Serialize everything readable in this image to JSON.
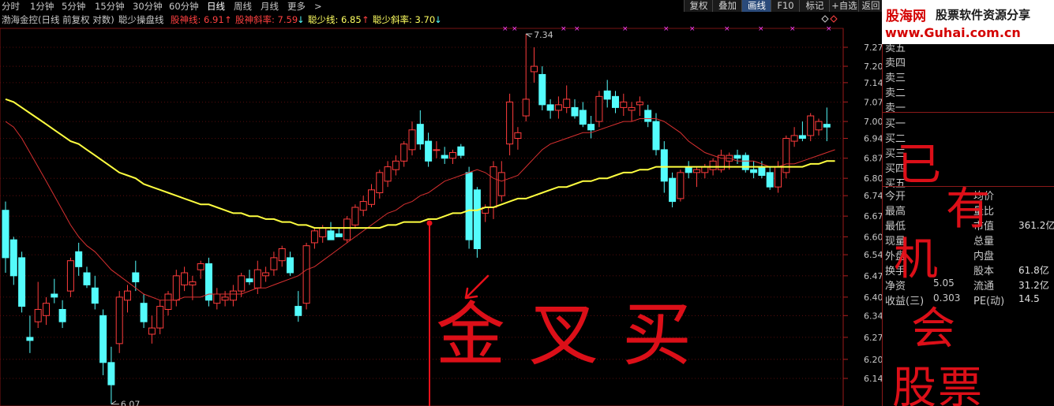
{
  "colors": {
    "up": "#ff3c3c",
    "down": "#54fcfc",
    "ma_red": "#d83030",
    "ma_yellow": "#ffff40",
    "grid": "#6e1010",
    "handwriting": "#e8101a"
  },
  "toolbar": {
    "periods": [
      "分时",
      "1分钟",
      "5分钟",
      "15分钟",
      "30分钟",
      "60分钟",
      "日线",
      "周线",
      "月线",
      "更多",
      ">"
    ],
    "active_period": "日线",
    "right_buttons": [
      "复权",
      "叠加",
      "画线",
      "F10",
      "标记",
      "+自选",
      "返回"
    ],
    "active_button": "画线"
  },
  "indicator": {
    "title": "渤海金控(日线 前复权 对数)",
    "formula": "聪少操盘线",
    "gs_label": "股神线: 6.91",
    "gs_slope_label": "股神斜率: 7.59",
    "cs_label": "聪少线: 6.85",
    "cs_slope_label": "聪少斜率: 3.70",
    "up_arrow": "↑",
    "down_arrow": "↓"
  },
  "price_axis": {
    "ticks": [
      "7.27",
      "7.20",
      "7.14",
      "7.07",
      "7.00",
      "6.94",
      "6.87",
      "6.80",
      "6.74",
      "6.67",
      "6.60",
      "6.54",
      "6.47",
      "6.40",
      "6.34",
      "6.27",
      "6.20",
      "6.14"
    ]
  },
  "annotations": {
    "high_label": "7.34",
    "low_label": "6.07",
    "marker": "×"
  },
  "handwriting": {
    "main": "金叉买",
    "side": "已有机会股票"
  },
  "panel": {
    "order_book": [
      "卖五",
      "卖四",
      "卖三",
      "卖二",
      "卖一",
      "买一",
      "买二",
      "买三",
      "买四",
      "买五"
    ],
    "stats_left": [
      "今开",
      "最高",
      "最低",
      "现量",
      "外盘",
      "换手",
      "净资",
      "收益(三)"
    ],
    "stats_left_values": [
      "",
      "",
      "",
      "",
      "",
      "",
      "5.05",
      "0.303"
    ],
    "stats_right": [
      "均价",
      "量比",
      "市值",
      "总量",
      "内盘",
      "股本",
      "流通",
      "PE(动)"
    ],
    "stats_right_values": [
      "",
      "",
      "361.2亿",
      "",
      "",
      "61.8亿",
      "31.2亿",
      "14.5"
    ]
  },
  "logo": {
    "brand": "股海网",
    "slogan": "股票软件资源分享",
    "url": "www.Guhai.com.cn"
  },
  "candles": [
    {
      "o": 6.69,
      "h": 6.72,
      "l": 6.48,
      "c": 6.53
    },
    {
      "o": 6.59,
      "h": 6.6,
      "l": 6.44,
      "c": 6.47
    },
    {
      "o": 6.53,
      "h": 6.55,
      "l": 6.35,
      "c": 6.37
    },
    {
      "o": 6.27,
      "h": 6.34,
      "l": 6.22,
      "c": 6.26
    },
    {
      "o": 6.32,
      "h": 6.45,
      "l": 6.3,
      "c": 6.36
    },
    {
      "o": 6.34,
      "h": 6.4,
      "l": 6.31,
      "c": 6.38
    },
    {
      "o": 6.41,
      "h": 6.46,
      "l": 6.38,
      "c": 6.4
    },
    {
      "o": 6.36,
      "h": 6.39,
      "l": 6.3,
      "c": 6.32
    },
    {
      "o": 6.42,
      "h": 6.53,
      "l": 6.4,
      "c": 6.52
    },
    {
      "o": 6.55,
      "h": 6.58,
      "l": 6.47,
      "c": 6.5
    },
    {
      "o": 6.48,
      "h": 6.5,
      "l": 6.43,
      "c": 6.44
    },
    {
      "o": 6.43,
      "h": 6.47,
      "l": 6.36,
      "c": 6.38
    },
    {
      "o": 6.34,
      "h": 6.36,
      "l": 6.15,
      "c": 6.19
    },
    {
      "o": 6.19,
      "h": 6.24,
      "l": 6.06,
      "c": 6.12
    },
    {
      "o": 6.25,
      "h": 6.42,
      "l": 6.22,
      "c": 6.4
    },
    {
      "o": 6.39,
      "h": 6.44,
      "l": 6.35,
      "c": 6.42
    },
    {
      "o": 6.48,
      "h": 6.52,
      "l": 6.42,
      "c": 6.45
    },
    {
      "o": 6.38,
      "h": 6.41,
      "l": 6.3,
      "c": 6.32
    },
    {
      "o": 6.28,
      "h": 6.34,
      "l": 6.25,
      "c": 6.3
    },
    {
      "o": 6.3,
      "h": 6.39,
      "l": 6.28,
      "c": 6.37
    },
    {
      "o": 6.36,
      "h": 6.42,
      "l": 6.34,
      "c": 6.41
    },
    {
      "o": 6.39,
      "h": 6.49,
      "l": 6.37,
      "c": 6.47
    },
    {
      "o": 6.44,
      "h": 6.5,
      "l": 6.42,
      "c": 6.48
    },
    {
      "o": 6.44,
      "h": 6.47,
      "l": 6.39,
      "c": 6.45
    },
    {
      "o": 6.49,
      "h": 6.52,
      "l": 6.46,
      "c": 6.51
    },
    {
      "o": 6.51,
      "h": 6.53,
      "l": 6.37,
      "c": 6.39
    },
    {
      "o": 6.38,
      "h": 6.43,
      "l": 6.36,
      "c": 6.41
    },
    {
      "o": 6.39,
      "h": 6.42,
      "l": 6.37,
      "c": 6.4
    },
    {
      "o": 6.39,
      "h": 6.44,
      "l": 6.37,
      "c": 6.42
    },
    {
      "o": 6.42,
      "h": 6.48,
      "l": 6.4,
      "c": 6.47
    },
    {
      "o": 6.46,
      "h": 6.49,
      "l": 6.44,
      "c": 6.45
    },
    {
      "o": 6.43,
      "h": 6.52,
      "l": 6.41,
      "c": 6.49
    },
    {
      "o": 6.47,
      "h": 6.5,
      "l": 6.45,
      "c": 6.48
    },
    {
      "o": 6.49,
      "h": 6.55,
      "l": 6.47,
      "c": 6.53
    },
    {
      "o": 6.52,
      "h": 6.57,
      "l": 6.5,
      "c": 6.56
    },
    {
      "o": 6.53,
      "h": 6.55,
      "l": 6.47,
      "c": 6.48
    },
    {
      "o": 6.37,
      "h": 6.42,
      "l": 6.32,
      "c": 6.34
    },
    {
      "o": 6.38,
      "h": 6.58,
      "l": 6.36,
      "c": 6.57
    },
    {
      "o": 6.58,
      "h": 6.63,
      "l": 6.56,
      "c": 6.62
    },
    {
      "o": 6.6,
      "h": 6.64,
      "l": 6.58,
      "c": 6.63
    },
    {
      "o": 6.62,
      "h": 6.65,
      "l": 6.59,
      "c": 6.59
    },
    {
      "o": 6.61,
      "h": 6.63,
      "l": 6.6,
      "c": 6.6
    },
    {
      "o": 6.59,
      "h": 6.67,
      "l": 6.58,
      "c": 6.66
    },
    {
      "o": 6.64,
      "h": 6.71,
      "l": 6.63,
      "c": 6.7
    },
    {
      "o": 6.69,
      "h": 6.74,
      "l": 6.67,
      "c": 6.72
    },
    {
      "o": 6.71,
      "h": 6.78,
      "l": 6.7,
      "c": 6.76
    },
    {
      "o": 6.75,
      "h": 6.83,
      "l": 6.73,
      "c": 6.82
    },
    {
      "o": 6.79,
      "h": 6.86,
      "l": 6.77,
      "c": 6.84
    },
    {
      "o": 6.83,
      "h": 6.88,
      "l": 6.81,
      "c": 6.86
    },
    {
      "o": 6.86,
      "h": 6.93,
      "l": 6.84,
      "c": 6.92
    },
    {
      "o": 6.9,
      "h": 7.0,
      "l": 6.88,
      "c": 6.97
    },
    {
      "o": 6.99,
      "h": 7.04,
      "l": 6.9,
      "c": 6.92
    },
    {
      "o": 6.93,
      "h": 6.96,
      "l": 6.84,
      "c": 6.86
    },
    {
      "o": 6.9,
      "h": 6.93,
      "l": 6.87,
      "c": 6.9
    },
    {
      "o": 6.88,
      "h": 6.91,
      "l": 6.85,
      "c": 6.87
    },
    {
      "o": 6.87,
      "h": 6.9,
      "l": 6.85,
      "c": 6.89
    },
    {
      "o": 6.91,
      "h": 6.92,
      "l": 6.87,
      "c": 6.88
    },
    {
      "o": 6.82,
      "h": 6.84,
      "l": 6.56,
      "c": 6.59
    },
    {
      "o": 6.76,
      "h": 6.77,
      "l": 6.53,
      "c": 6.56
    },
    {
      "o": 6.68,
      "h": 6.71,
      "l": 6.65,
      "c": 6.7
    },
    {
      "o": 6.7,
      "h": 6.86,
      "l": 6.66,
      "c": 6.84
    },
    {
      "o": 6.74,
      "h": 6.86,
      "l": 6.72,
      "c": 6.82
    },
    {
      "o": 6.92,
      "h": 7.1,
      "l": 6.88,
      "c": 7.07
    },
    {
      "o": 6.94,
      "h": 6.98,
      "l": 6.9,
      "c": 6.96
    },
    {
      "o": 7.02,
      "h": 7.32,
      "l": 7.0,
      "c": 7.08
    },
    {
      "o": 7.18,
      "h": 7.27,
      "l": 7.14,
      "c": 7.2
    },
    {
      "o": 7.17,
      "h": 7.2,
      "l": 7.04,
      "c": 7.06
    },
    {
      "o": 7.06,
      "h": 7.08,
      "l": 7.01,
      "c": 7.04
    },
    {
      "o": 7.04,
      "h": 7.09,
      "l": 7.01,
      "c": 7.06
    },
    {
      "o": 7.05,
      "h": 7.13,
      "l": 7.03,
      "c": 7.08
    },
    {
      "o": 7.05,
      "h": 7.08,
      "l": 7.01,
      "c": 7.02
    },
    {
      "o": 7.04,
      "h": 7.07,
      "l": 6.98,
      "c": 6.99
    },
    {
      "o": 6.99,
      "h": 7.02,
      "l": 6.94,
      "c": 6.97
    },
    {
      "o": 7.0,
      "h": 7.11,
      "l": 6.98,
      "c": 7.09
    },
    {
      "o": 7.11,
      "h": 7.15,
      "l": 7.05,
      "c": 7.08
    },
    {
      "o": 7.09,
      "h": 7.11,
      "l": 7.03,
      "c": 7.05
    },
    {
      "o": 7.05,
      "h": 7.1,
      "l": 7.02,
      "c": 7.07
    },
    {
      "o": 7.04,
      "h": 7.07,
      "l": 7.0,
      "c": 7.05
    },
    {
      "o": 7.06,
      "h": 7.09,
      "l": 7.02,
      "c": 7.07
    },
    {
      "o": 7.04,
      "h": 7.06,
      "l": 6.98,
      "c": 7.0
    },
    {
      "o": 7.0,
      "h": 7.03,
      "l": 6.88,
      "c": 6.9
    },
    {
      "o": 6.9,
      "h": 6.93,
      "l": 6.75,
      "c": 6.79
    },
    {
      "o": 6.8,
      "h": 6.82,
      "l": 6.7,
      "c": 6.72
    },
    {
      "o": 6.73,
      "h": 6.83,
      "l": 6.72,
      "c": 6.82
    },
    {
      "o": 6.84,
      "h": 6.86,
      "l": 6.8,
      "c": 6.82
    },
    {
      "o": 6.82,
      "h": 6.84,
      "l": 6.77,
      "c": 6.83
    },
    {
      "o": 6.82,
      "h": 6.85,
      "l": 6.8,
      "c": 6.84
    },
    {
      "o": 6.83,
      "h": 6.87,
      "l": 6.81,
      "c": 6.86
    },
    {
      "o": 6.83,
      "h": 6.9,
      "l": 6.82,
      "c": 6.88
    },
    {
      "o": 6.86,
      "h": 6.89,
      "l": 6.83,
      "c": 6.88
    },
    {
      "o": 6.88,
      "h": 6.9,
      "l": 6.85,
      "c": 6.87
    },
    {
      "o": 6.88,
      "h": 6.89,
      "l": 6.82,
      "c": 6.83
    },
    {
      "o": 6.83,
      "h": 6.86,
      "l": 6.8,
      "c": 6.82
    },
    {
      "o": 6.84,
      "h": 6.86,
      "l": 6.8,
      "c": 6.81
    },
    {
      "o": 6.82,
      "h": 6.84,
      "l": 6.76,
      "c": 6.77
    },
    {
      "o": 6.77,
      "h": 6.86,
      "l": 6.75,
      "c": 6.84
    },
    {
      "o": 6.82,
      "h": 6.95,
      "l": 6.8,
      "c": 6.94
    },
    {
      "o": 6.93,
      "h": 6.98,
      "l": 6.91,
      "c": 6.95
    },
    {
      "o": 6.95,
      "h": 7.0,
      "l": 6.93,
      "c": 6.94
    },
    {
      "o": 6.95,
      "h": 7.03,
      "l": 6.93,
      "c": 7.02
    },
    {
      "o": 6.97,
      "h": 7.01,
      "l": 6.95,
      "c": 7.0
    },
    {
      "o": 6.99,
      "h": 7.05,
      "l": 6.93,
      "c": 6.98
    }
  ],
  "ma_red": [
    7.0,
    6.98,
    6.94,
    6.89,
    6.84,
    6.79,
    6.74,
    6.69,
    6.64,
    6.6,
    6.57,
    6.55,
    6.52,
    6.49,
    6.47,
    6.45,
    6.43,
    6.41,
    6.4,
    6.39,
    6.39,
    6.39,
    6.4,
    6.4,
    6.4,
    6.41,
    6.41,
    6.41,
    6.41,
    6.41,
    6.42,
    6.43,
    6.43,
    6.44,
    6.45,
    6.46,
    6.47,
    6.49,
    6.5,
    6.52,
    6.54,
    6.56,
    6.58,
    6.6,
    6.62,
    6.64,
    6.66,
    6.68,
    6.69,
    6.71,
    6.72,
    6.74,
    6.75,
    6.77,
    6.79,
    6.8,
    6.81,
    6.82,
    6.83,
    6.82,
    6.8,
    6.79,
    6.8,
    6.81,
    6.84,
    6.87,
    6.9,
    6.92,
    6.93,
    6.94,
    6.95,
    6.96,
    6.96,
    6.97,
    6.98,
    6.99,
    7.0,
    7.0,
    7.01,
    7.01,
    7.01,
    7.0,
    6.98,
    6.96,
    6.93,
    6.91,
    6.89,
    6.88,
    6.87,
    6.87,
    6.86,
    6.86,
    6.86,
    6.85,
    6.84,
    6.84,
    6.85,
    6.85,
    6.86,
    6.87,
    6.88,
    6.89,
    6.9
  ],
  "ma_yellow": [
    7.08,
    7.07,
    7.05,
    7.03,
    7.01,
    6.99,
    6.97,
    6.95,
    6.93,
    6.92,
    6.9,
    6.88,
    6.86,
    6.84,
    6.82,
    6.81,
    6.8,
    6.78,
    6.77,
    6.76,
    6.75,
    6.74,
    6.73,
    6.72,
    6.71,
    6.71,
    6.7,
    6.69,
    6.68,
    6.68,
    6.67,
    6.67,
    6.66,
    6.66,
    6.65,
    6.65,
    6.64,
    6.64,
    6.63,
    6.63,
    6.63,
    6.63,
    6.63,
    6.63,
    6.63,
    6.63,
    6.63,
    6.64,
    6.64,
    6.65,
    6.65,
    6.65,
    6.66,
    6.66,
    6.67,
    6.68,
    6.68,
    6.69,
    6.69,
    6.7,
    6.7,
    6.71,
    6.72,
    6.73,
    6.73,
    6.74,
    6.75,
    6.76,
    6.77,
    6.77,
    6.78,
    6.79,
    6.79,
    6.8,
    6.8,
    6.81,
    6.82,
    6.82,
    6.83,
    6.83,
    6.84,
    6.84,
    6.84,
    6.84,
    6.84,
    6.84,
    6.84,
    6.84,
    6.84,
    6.84,
    6.84,
    6.84,
    6.84,
    6.84,
    6.84,
    6.84,
    6.84,
    6.84,
    6.84,
    6.85,
    6.85,
    6.86,
    6.86
  ]
}
